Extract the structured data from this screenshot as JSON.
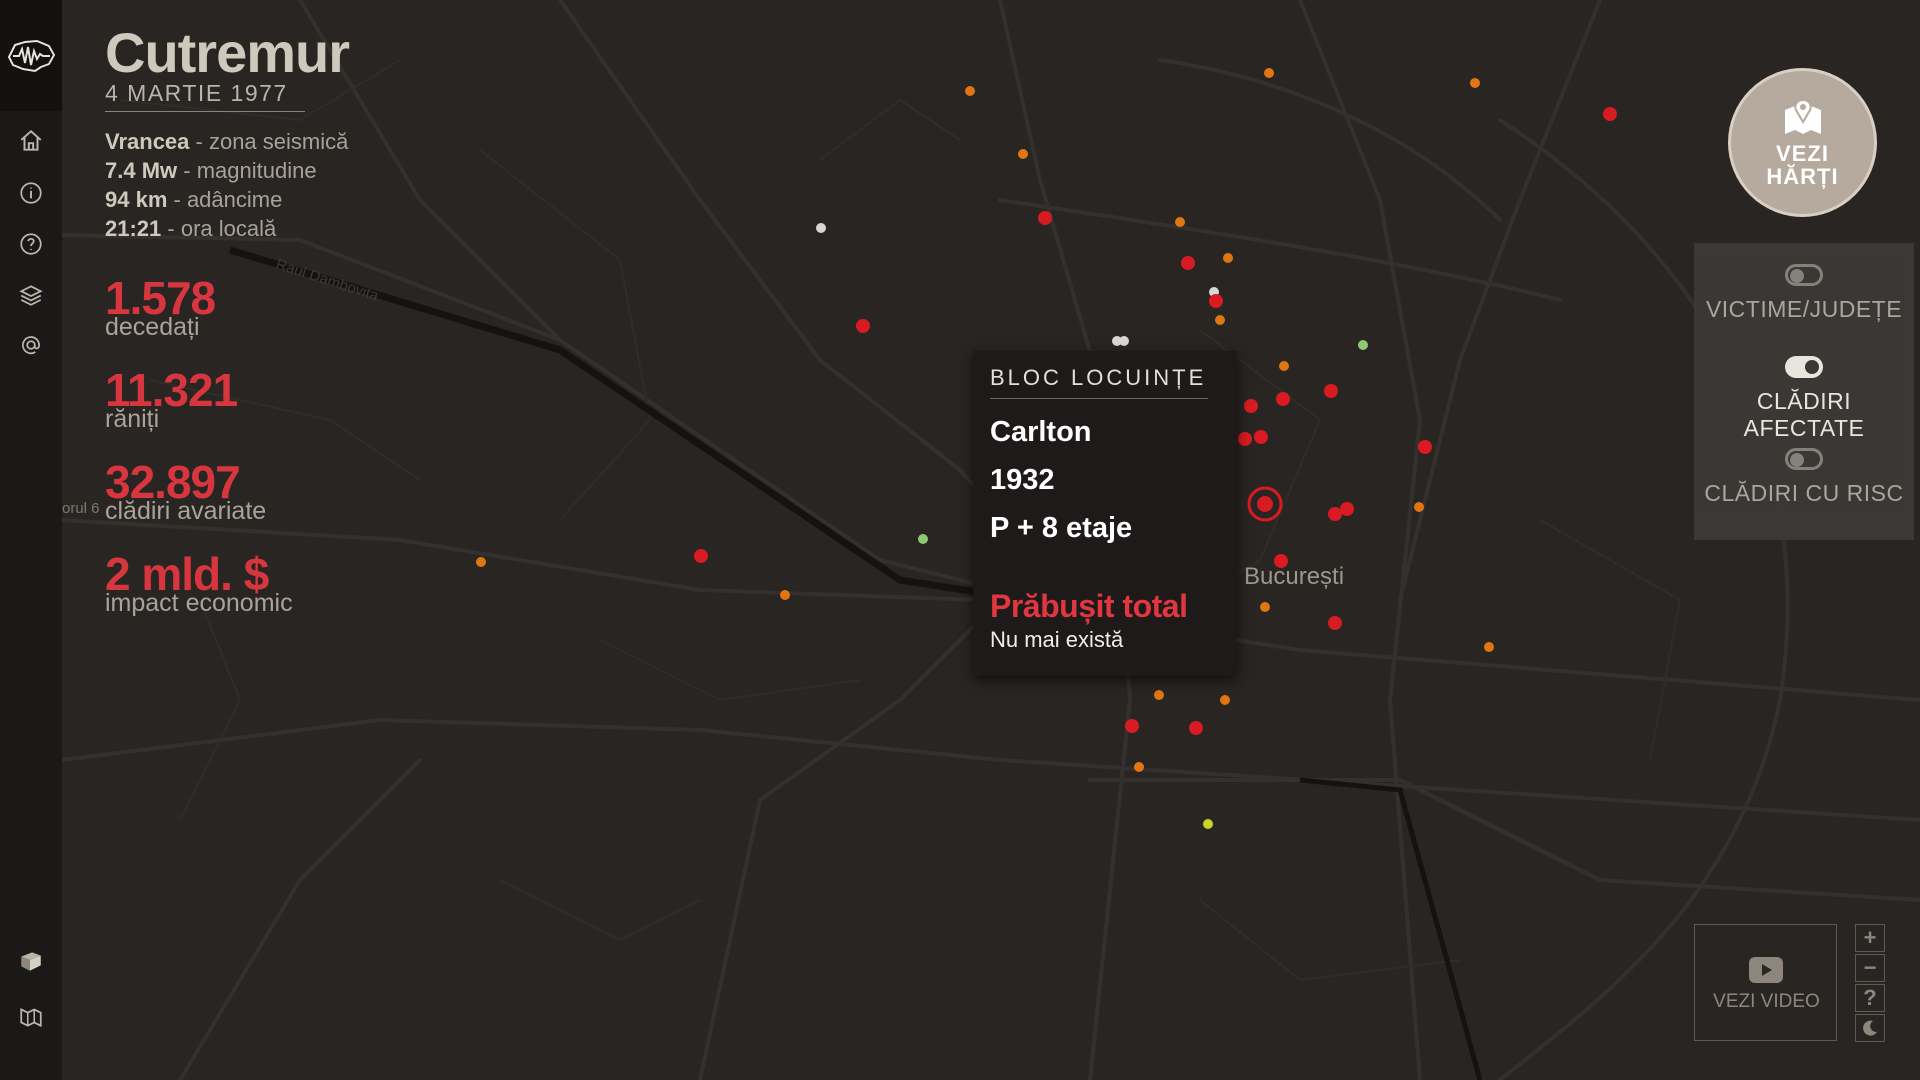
{
  "app": {
    "title": "Cutremur",
    "date": "4 MARTIE 1977"
  },
  "facts": [
    {
      "value": "Vrancea",
      "label": " - zona seismică"
    },
    {
      "value": "7.4 Mw",
      "label": " - magnitudine"
    },
    {
      "value": "94 km",
      "label": " - adâncime"
    },
    {
      "value": "21:21",
      "label": " - ora locală"
    }
  ],
  "stats": [
    {
      "value": "1.578",
      "label": "decedați"
    },
    {
      "value": "11.321",
      "label": "răniți"
    },
    {
      "value": "32.897",
      "label": "clădiri avariate"
    },
    {
      "value": "2 mld. $",
      "label": "impact economic"
    }
  ],
  "nav": {
    "icons": [
      "home-icon",
      "info-icon",
      "help-icon",
      "layers-icon",
      "at-icon"
    ],
    "bottom_icons": [
      "book-icon",
      "map-brand-icon"
    ]
  },
  "map_labels": {
    "city": "București",
    "street": "Raul Dambovita",
    "sector": "orul 6"
  },
  "popup": {
    "type": "BLOC LOCUINȚE",
    "name": "Carlton",
    "year": "1932",
    "floors": "P + 8 etaje",
    "status": "Prăbușit total",
    "note": "Nu mai există"
  },
  "maps_button": {
    "line1": "VEZI",
    "line2": "HĂRȚI",
    "icon": "map-pin-icon"
  },
  "toggles": [
    {
      "label": "VICTIME/JUDEȚE",
      "on": false
    },
    {
      "label": "CLĂDIRI AFECTATE",
      "on": true
    },
    {
      "label": "CLĂDIRI CU RISC",
      "on": false
    }
  ],
  "video": {
    "label": "VEZI VIDEO",
    "icon": "youtube-play-icon"
  },
  "zoom": {
    "in": "+",
    "out": "−",
    "help": "?",
    "theme": "moon-icon"
  },
  "colors": {
    "red": "#d81b22",
    "orange": "#e07514",
    "green": "#8fc86e",
    "white": "#d8d8d8",
    "yellow": "#c8d22a",
    "accent": "#d8363e"
  }
}
